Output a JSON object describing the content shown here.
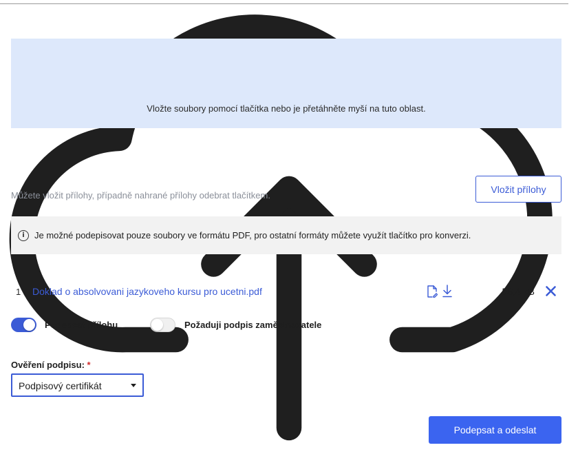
{
  "upload": {
    "icon": "cloud-upload-icon",
    "text": "Vložte soubory pomocí tlačítka nebo je přetáhněte myší na tuto oblast."
  },
  "attachments": {
    "hint": "Můžete vložit přílohy, případně nahrané přílohy odebrat tlačítkem.",
    "insert_label": "Vložit přílohy"
  },
  "info": {
    "icon": "info-icon",
    "symbol": "i",
    "text": "Je možné podepisovat pouze soubory ve formátu PDF, pro ostatní formáty můžete využít tlačítko pro konverzi."
  },
  "files": [
    {
      "index": "1",
      "name": "Doklad o absolvovani jazykoveho kursu pro ucetni.pdf",
      "size": "58,4 kB",
      "icons": [
        "sign-document-icon",
        "download-icon",
        "close-icon"
      ]
    }
  ],
  "toggles": {
    "sign_attachment": {
      "label": "Podepsat přílohu",
      "on": true
    },
    "employer_signature": {
      "label": "Požaduji podpis zaměstnavatele",
      "on": false
    }
  },
  "verification": {
    "label": "Ověření podpisu:",
    "required_mark": "*",
    "selected": "Podpisový certifikát"
  },
  "submit": {
    "label": "Podepsat a odeslat"
  },
  "colors": {
    "accent": "#3b5bd6",
    "primary_button": "#3b64f0",
    "dropzone_bg": "#dde8fb",
    "info_bg": "#f2f2f2",
    "required": "#d12c2c"
  }
}
